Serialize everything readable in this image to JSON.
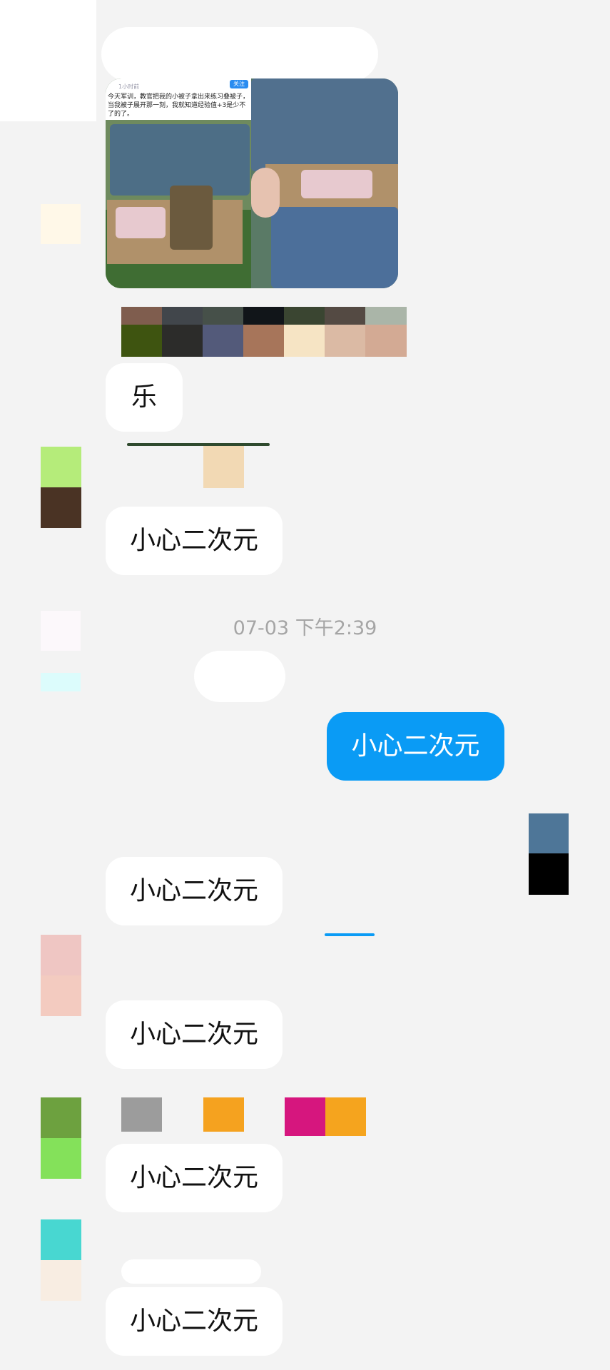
{
  "chat": {
    "image_message": {
      "post_follow_label": "关注",
      "post_username": "1小时前",
      "post_text": "今天军训，教官把我的小被子拿出来练习叠被子，当我被子展开那一刻，我就知道经验值+3是少不了的了。"
    },
    "messages": [
      {
        "text": "乐",
        "side": "left"
      },
      {
        "text": "小心二次元",
        "side": "left"
      },
      {
        "text": "小心二次元",
        "side": "right"
      },
      {
        "text": "小心二次元",
        "side": "left"
      },
      {
        "text": "小心二次元",
        "side": "left"
      },
      {
        "text": "小心二次元",
        "side": "left"
      },
      {
        "text": "小心二次元",
        "side": "left"
      }
    ],
    "timestamp": "07-03 下午2:39"
  },
  "colors": {
    "background": "#f3f3f3",
    "bubble_left": "#ffffff",
    "bubble_right": "#0a9bf5",
    "timestamp_text": "#a5a5a5"
  }
}
